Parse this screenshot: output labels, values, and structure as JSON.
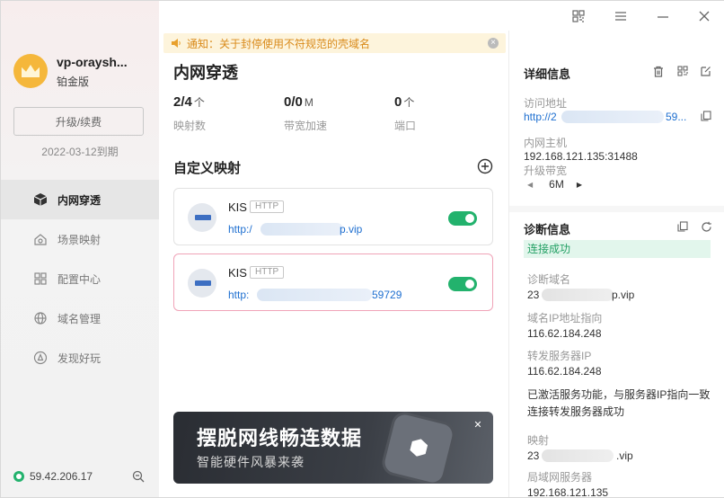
{
  "account": {
    "name": "vp-oraysh...",
    "tier": "铂金版",
    "upgrade_label": "升级/续费",
    "expire": "2022-03-12到期"
  },
  "nav": [
    {
      "label": "内网穿透",
      "icon": "cube-icon",
      "active": true
    },
    {
      "label": "场景映射",
      "icon": "scene-icon",
      "active": false
    },
    {
      "label": "配置中心",
      "icon": "grid-icon",
      "active": false
    },
    {
      "label": "域名管理",
      "icon": "globe-icon",
      "active": false
    },
    {
      "label": "发现好玩",
      "icon": "compass-icon",
      "active": false
    }
  ],
  "footer": {
    "ip": "59.42.206.17"
  },
  "notice": {
    "text": "通知：关于封停使用不符规范的壳域名"
  },
  "main": {
    "title": "内网穿透",
    "stats": [
      {
        "value": "2/4",
        "unit": "个",
        "label": "映射数"
      },
      {
        "value": "0/0",
        "unit": "M",
        "label": "带宽加速"
      },
      {
        "value": "0",
        "unit": "个",
        "label": "端口"
      }
    ],
    "section_title": "自定义映射",
    "mappings": [
      {
        "name": "KIS",
        "tag": "HTTP",
        "url_prefix": "http:/",
        "url_suffix": "p.vip",
        "enabled": true
      },
      {
        "name": "KIS",
        "tag": "HTTP",
        "url_prefix": "http:",
        "url_suffix": "59729",
        "enabled": true
      }
    ],
    "banner": {
      "line1": "摆脱网线畅连数据",
      "line2": "智能硬件风暴来袭"
    }
  },
  "detail": {
    "title": "详细信息",
    "access_label": "访问地址",
    "access_prefix": "http://2",
    "access_suffix": "59...",
    "host_label": "内网主机",
    "host_value": "192.168.121.135:31488",
    "bw_label": "升级带宽",
    "bw_value": "6M"
  },
  "diag": {
    "title": "诊断信息",
    "status": "连接成功",
    "domain_label": "诊断域名",
    "domain_prefix": "23",
    "domain_suffix": "p.vip",
    "dns_label": "域名IP地址指向",
    "dns_value": "116.62.184.248",
    "relay_label": "转发服务器IP",
    "relay_value": "116.62.184.248",
    "msg1": "已激活服务功能，与服务器IP指向一致",
    "msg2": "连接转发服务器成功",
    "map_label": "映射",
    "map_prefix": "23",
    "map_suffix": ".vip",
    "lan_label": "局域网服务器",
    "lan_value": "192.168.121.135"
  }
}
